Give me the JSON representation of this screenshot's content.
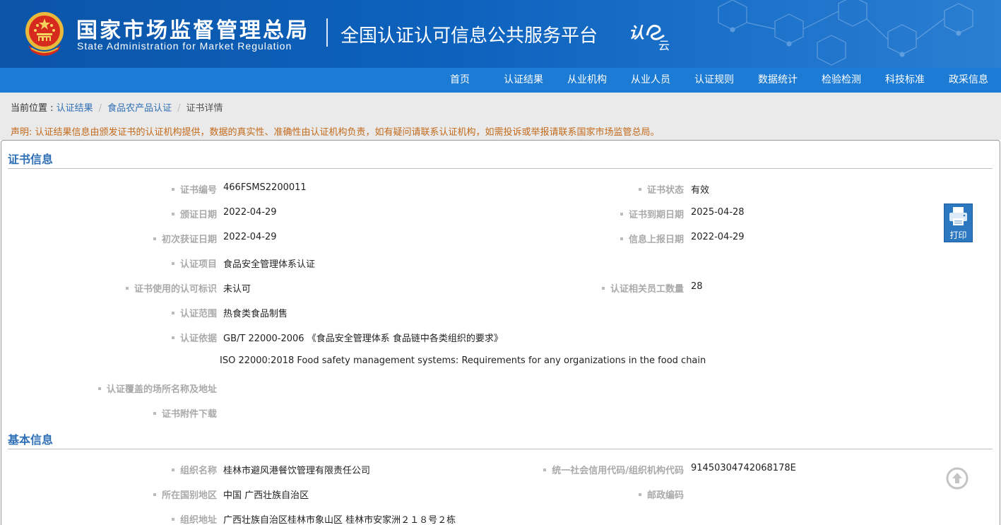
{
  "header": {
    "agency_cn": "国家市场监督管理总局",
    "agency_en": "State Administration for Market Regulation",
    "platform": "全国认证认可信息公共服务平台",
    "logo_text": "认e云",
    "brand_color": "#0d62bd",
    "nav_color": "#1c7bd4"
  },
  "nav": {
    "items": [
      "首页",
      "认证结果",
      "从业机构",
      "从业人员",
      "认证规则",
      "数据统计",
      "检验检测",
      "科技标准",
      "政采信息"
    ]
  },
  "breadcrumb": {
    "prefix": "当前位置 : ",
    "items": [
      "认证结果",
      "食品农产品认证",
      "证书详情"
    ]
  },
  "notice": "声明: 认证结果信息由颁发证书的认证机构提供，数据的真实性、准确性由认证机构负责，如有疑问请联系认证机构，如需投诉或举报请联系国家市场监管总局。",
  "cert_section": {
    "title": "证书信息",
    "fields": {
      "cert_no_label": "证书编号",
      "cert_no": "466FSMS2200011",
      "status_label": "证书状态",
      "status": "有效",
      "issue_date_label": "颁证日期",
      "issue_date": "2022-04-29",
      "expiry_label": "证书到期日期",
      "expiry": "2025-04-28",
      "first_date_label": "初次获证日期",
      "first_date": "2022-04-29",
      "report_date_label": "信息上报日期",
      "report_date": "2022-04-29",
      "project_label": "认证项目",
      "project": "食品安全管理体系认证",
      "mark_label": "证书使用的认可标识",
      "mark": "未认可",
      "staff_label": "认证相关员工数量",
      "staff": "28",
      "scope_label": "认证范围",
      "scope": "热食类食品制售",
      "basis_label": "认证依据",
      "basis_1": "GB/T 22000-2006 《食品安全管理体系 食品链中各类组织的要求》",
      "basis_2": "ISO 22000:2018 Food safety management systems: Requirements for any organizations in the food chain",
      "sites_label": "认证覆盖的场所名称及地址",
      "attach_label": "证书附件下载"
    }
  },
  "basic_section": {
    "title": "基本信息",
    "fields": {
      "org_name_label": "组织名称",
      "org_name": "桂林市避风港餐饮管理有限责任公司",
      "credit_label": "统一社会信用代码/组织机构代码",
      "credit": "91450304742068178E",
      "region_label": "所在国别地区",
      "region": "中国 广西壮族自治区",
      "postcode_label": "邮政编码",
      "address_label": "组织地址",
      "address": "广西壮族自治区桂林市象山区 桂林市安家洲２１８号２栋"
    }
  },
  "print_button": {
    "label": "打印",
    "icon": "printer-icon"
  },
  "back_to_top": {
    "icon": "arrow-up-circle-icon"
  }
}
